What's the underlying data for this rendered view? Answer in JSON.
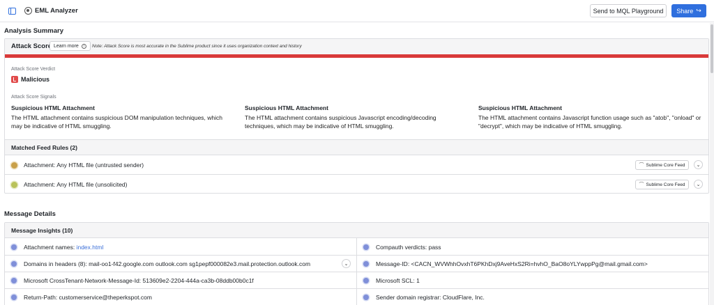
{
  "header": {
    "app_title": "EML Analyzer",
    "mql_button": "Send to MQL Playground",
    "share_button": "Share",
    "share_icon": "↪"
  },
  "analysis": {
    "heading": "Analysis Summary",
    "attack_score_title": "Attack Score",
    "learn_more": "Learn more",
    "note": "Note: Attack Score is most accurate in the Sublime product since it uses organization context and history",
    "score_bar_color": "#d93a3a",
    "verdict_label": "Attack Score Verdict",
    "verdict": "Malicious",
    "signals_label": "Attack Score Signals",
    "signals": [
      {
        "title": "Suspicious HTML Attachment",
        "desc": "The HTML attachment contains suspicious DOM manipulation techniques, which may be indicative of HTML smuggling."
      },
      {
        "title": "Suspicious HTML Attachment",
        "desc": "The HTML attachment contains suspicious Javascript encoding/decoding techniques, which may be indicative of HTML smuggling."
      },
      {
        "title": "Suspicious HTML Attachment",
        "desc": "The HTML attachment contains Javascript function usage such as \"atob\", \"onload\" or \"decrypt\", which may be indicative of HTML smuggling."
      }
    ],
    "rules_header": "Matched Feed Rules (2)",
    "rules": [
      {
        "name": "Attachment: Any HTML file (untrusted sender)",
        "feed": "Sublime Core Feed",
        "dot_color": "#c9a049"
      },
      {
        "name": "Attachment: Any HTML file (unsolicited)",
        "feed": "Sublime Core Feed",
        "dot_color": "#b9c25a"
      }
    ]
  },
  "message": {
    "heading": "Message Details",
    "insights_header": "Message Insights (10)",
    "insights": [
      {
        "label": "Attachment names: ",
        "value": "index.html"
      },
      {
        "label": "Compauth verdicts: pass",
        "value": ""
      },
      {
        "label": "Domains in headers (8): mail-oo1-f42.google.com  outlook.com  sg1pepf000082e3.mail.protection.outlook.com",
        "value": ""
      },
      {
        "label": "Message-ID: <CACN_WVWhhOvxhT6PKhDxj9AveHxS2Ri=hvhO_BaO8oYLYwppPg@mail.gmail.com>",
        "value": ""
      },
      {
        "label": "Microsoft CrossTenant-Network-Message-Id: 513609e2-2204-444a-ca3b-08ddb00b0c1f",
        "value": ""
      },
      {
        "label": "Microsoft SCL: 1",
        "value": ""
      },
      {
        "label": "Return-Path: customerservice@theperkspot.com",
        "value": ""
      },
      {
        "label": "Sender domain registrar: CloudFlare, Inc.",
        "value": ""
      }
    ]
  }
}
